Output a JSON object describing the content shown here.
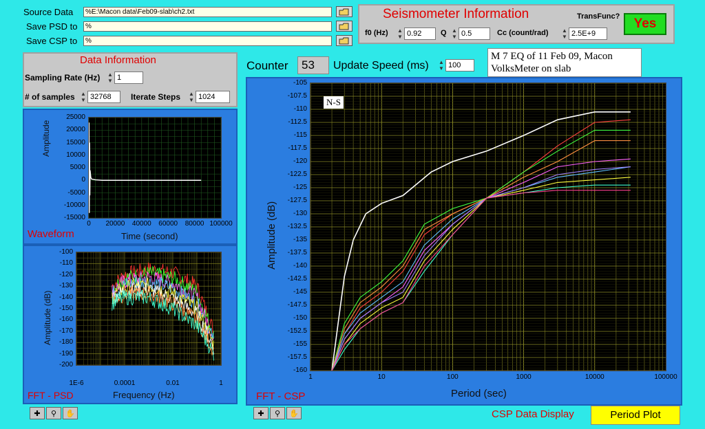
{
  "files": {
    "source_label": "Source Data",
    "source_path": "E:\\Macon data\\Feb09-slab\\ch2.txt",
    "psd_label": "Save PSD to",
    "psd_path": "",
    "csp_label": "Save CSP to",
    "csp_path": "",
    "path_prefix": "%"
  },
  "seismometer": {
    "title": "Seismometer Information",
    "transfunc_label": "TransFunc?",
    "transfunc_value": "Yes",
    "f0_label": "f0 (Hz)",
    "f0_value": "0.92",
    "q_label": "Q",
    "q_value": "0.5",
    "cc_label": "Cc (count/rad)",
    "cc_value": "2.5E+9"
  },
  "data_info": {
    "title": "Data Information",
    "sampling_label": "Sampling Rate (Hz)",
    "sampling_value": "1",
    "samples_label": "# of samples",
    "samples_value": "32768",
    "iterate_label": "Iterate Steps",
    "iterate_value": "1024"
  },
  "counter": {
    "label": "Counter",
    "value": "53",
    "speed_label": "Update Speed (ms)",
    "speed_value": "100"
  },
  "annotation": {
    "line1": "M 7 EQ of 11 Feb 09, Macon",
    "line2": "VolksMeter on slab"
  },
  "waveform": {
    "panel_title": "Waveform",
    "ylabel": "Amplitude",
    "xlabel": "Time (second)",
    "yticks": [
      "25000",
      "20000",
      "15000",
      "10000",
      "5000",
      "0",
      "-5000",
      "-10000",
      "-15000"
    ],
    "xticks": [
      "0",
      "20000",
      "40000",
      "60000",
      "80000",
      "100000"
    ]
  },
  "fft_psd": {
    "panel_title": "FFT - PSD",
    "ylabel": "Amplitude (dB)",
    "xlabel": "Frequency (Hz)",
    "yticks": [
      "-100",
      "-110",
      "-120",
      "-130",
      "-140",
      "-150",
      "-160",
      "-170",
      "-180",
      "-190",
      "-200"
    ],
    "xticks": [
      "1E-6",
      "0.0001",
      "0.01",
      "1"
    ]
  },
  "fft_csp": {
    "panel_title": "FFT - CSP",
    "ylabel": "Amplitude (dB)",
    "xlabel": "Period (sec)",
    "channel": "N-S",
    "yticks": [
      "-105",
      "-107.5",
      "-110",
      "-112.5",
      "-115",
      "-117.5",
      "-120",
      "-122.5",
      "-125",
      "-127.5",
      "-130",
      "-132.5",
      "-135",
      "-137.5",
      "-140",
      "-142.5",
      "-145",
      "-147.5",
      "-150",
      "-152.5",
      "-155",
      "-157.5",
      "-160"
    ],
    "xticks": [
      "1",
      "10",
      "100",
      "1000",
      "10000",
      "100000"
    ]
  },
  "display": {
    "csp_label": "CSP Data Display",
    "mode": "Period Plot"
  },
  "chart_data": [
    {
      "type": "line",
      "title": "Waveform",
      "xlabel": "Time (second)",
      "ylabel": "Amplitude",
      "xlim": [
        0,
        100000
      ],
      "ylim": [
        -15000,
        25000
      ],
      "series": [
        {
          "x": [
            0,
            200,
            400,
            600,
            800,
            1000,
            1500,
            2000,
            5000,
            10000,
            30000,
            60000,
            85000
          ],
          "values": [
            0,
            23000,
            -13000,
            15000,
            -6000,
            4000,
            1200,
            500,
            200,
            0,
            0,
            0,
            0
          ]
        }
      ]
    },
    {
      "type": "line",
      "title": "FFT - PSD",
      "xlabel": "Frequency (Hz)",
      "ylabel": "Amplitude (dB)",
      "xlim": [
        1e-06,
        1
      ],
      "ylim": [
        -200,
        -100
      ],
      "log_x": true,
      "series": [
        {
          "x": [
            3e-05,
            0.0001,
            0.001,
            0.01,
            0.1,
            0.5
          ],
          "values": [
            -130,
            -120,
            -115,
            -118,
            -130,
            -170
          ]
        },
        {
          "x": [
            3e-05,
            0.0001,
            0.001,
            0.01,
            0.1,
            0.5
          ],
          "values": [
            -145,
            -140,
            -140,
            -150,
            -165,
            -190
          ]
        }
      ]
    },
    {
      "type": "line",
      "title": "FFT - CSP",
      "xlabel": "Period (sec)",
      "ylabel": "Amplitude (dB)",
      "xlim": [
        1,
        100000
      ],
      "ylim": [
        -160,
        -105
      ],
      "log_x": true,
      "grid": true,
      "series": [
        {
          "color": "#ffffff",
          "x": [
            2,
            2.5,
            3,
            4,
            6,
            10,
            20,
            50,
            100,
            300,
            1000,
            3000,
            10000,
            32000
          ],
          "values": [
            -160,
            -150,
            -142,
            -135,
            -130,
            -128,
            -126.5,
            -122,
            -120,
            -118,
            -115,
            -112,
            -110.5,
            -110.5
          ]
        },
        {
          "color": "#ff4040",
          "x": [
            2,
            3,
            5,
            10,
            20,
            40,
            100,
            300,
            1000,
            3000,
            10000,
            32000
          ],
          "values": [
            -160,
            -153,
            -148,
            -145,
            -141,
            -134,
            -130,
            -127,
            -122,
            -117,
            -112.5,
            -112
          ]
        },
        {
          "color": "#40ff40",
          "x": [
            2,
            3,
            5,
            10,
            20,
            40,
            100,
            300,
            1000,
            3000,
            10000,
            32000
          ],
          "values": [
            -160,
            -151,
            -146,
            -143,
            -139,
            -132,
            -129,
            -127,
            -122,
            -118,
            -114,
            -114
          ]
        },
        {
          "color": "#ff60ff",
          "x": [
            2,
            3,
            5,
            10,
            20,
            40,
            100,
            300,
            1000,
            3000,
            10000,
            32000
          ],
          "values": [
            -160,
            -154,
            -150,
            -147,
            -144,
            -137,
            -132,
            -127,
            -124,
            -121,
            -120,
            -119.5
          ]
        },
        {
          "color": "#60c0ff",
          "x": [
            2,
            3,
            5,
            10,
            20,
            40,
            100,
            300,
            1000,
            3000,
            10000,
            32000
          ],
          "values": [
            -160,
            -153,
            -149,
            -146,
            -143,
            -136,
            -131,
            -127,
            -125,
            -123,
            -122,
            -121
          ]
        },
        {
          "color": "#ffff40",
          "x": [
            2,
            3,
            5,
            10,
            20,
            40,
            100,
            300,
            1000,
            3000,
            10000,
            32000
          ],
          "values": [
            -160,
            -155,
            -151,
            -148,
            -146,
            -139,
            -133,
            -127,
            -125.5,
            -124,
            -123.5,
            -123
          ]
        },
        {
          "color": "#ff9040",
          "x": [
            2,
            3,
            5,
            10,
            20,
            40,
            100,
            300,
            1000,
            3000,
            10000,
            32000
          ],
          "values": [
            -160,
            -152,
            -147,
            -144,
            -140,
            -133,
            -130,
            -127,
            -123,
            -120,
            -116,
            -116
          ]
        },
        {
          "color": "#40ffd0",
          "x": [
            2,
            3,
            5,
            10,
            20,
            40,
            100,
            300,
            1000,
            3000,
            10000,
            32000
          ],
          "values": [
            -160,
            -156,
            -152,
            -149,
            -147,
            -141,
            -134,
            -127,
            -126,
            -125,
            -124.5,
            -124.5
          ]
        },
        {
          "color": "#a080ff",
          "x": [
            2,
            3,
            5,
            10,
            20,
            40,
            100,
            300,
            1000,
            3000,
            10000,
            32000
          ],
          "values": [
            -160,
            -154,
            -150,
            -147,
            -145,
            -138,
            -132,
            -127,
            -125,
            -122.5,
            -121.5,
            -121
          ]
        },
        {
          "color": "#ff4090",
          "x": [
            2,
            3,
            5,
            10,
            20,
            40,
            100,
            300,
            1000,
            3000,
            10000,
            32000
          ],
          "values": [
            -160,
            -155,
            -152,
            -149,
            -147,
            -140,
            -134,
            -127,
            -126,
            -125.5,
            -125.5,
            -125.5
          ]
        }
      ]
    }
  ]
}
